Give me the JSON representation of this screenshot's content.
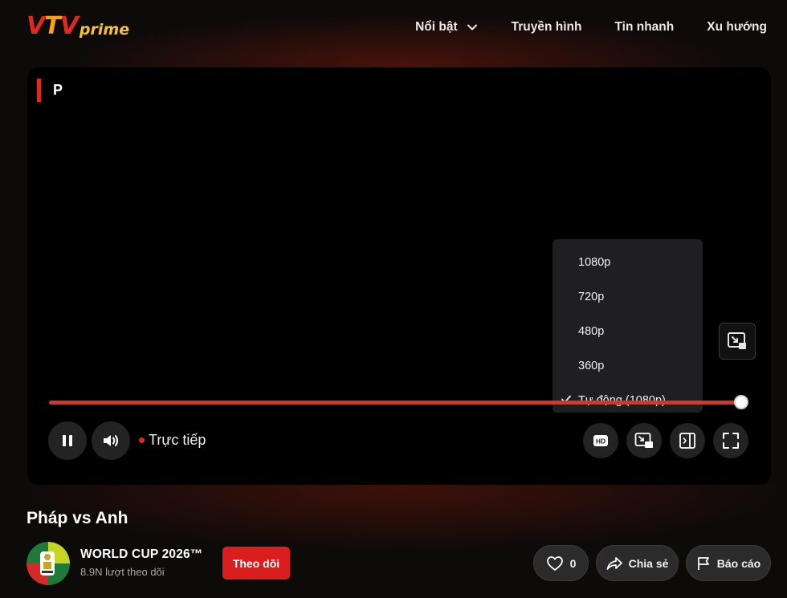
{
  "header": {
    "logo": {
      "vtv": "VTV",
      "prime": "prime"
    },
    "nav": [
      {
        "label": "Nổi bật",
        "has_dropdown": true,
        "icon": "chevron-down-icon"
      },
      {
        "label": "Truyền hình"
      },
      {
        "label": "Tin nhanh"
      },
      {
        "label": "Xu hướng"
      }
    ]
  },
  "player": {
    "title": "P",
    "progress_fraction": 1.0,
    "live_label": "Trực tiếp",
    "quality_menu": {
      "options": [
        "1080p",
        "720p",
        "480p",
        "360p",
        "Tự động (1080p)"
      ],
      "selected": "Tự động (1080p)"
    },
    "controls": {
      "left": [
        "pause-icon",
        "volume-icon"
      ],
      "right": [
        "hd-icon",
        "picture-in-picture-icon",
        "sidebar-toggle-icon",
        "fullscreen-icon"
      ],
      "side": "picture-in-picture-exit-icon"
    }
  },
  "video": {
    "title": "Pháp vs Anh",
    "channel_name": "WORLD CUP 2026™",
    "subscribers": "8.9N lượt theo dõi",
    "follow_label": "Theo dõi",
    "likes": "0",
    "share_label": "Chia sẻ",
    "report_label": "Báo cáo"
  },
  "colors": {
    "accent": "#e0281e",
    "brand_orange": "#f5a21c",
    "background": "#0d0a0a"
  }
}
